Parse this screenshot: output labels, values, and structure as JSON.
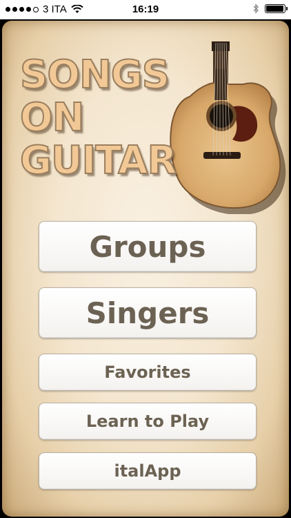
{
  "status_bar": {
    "carrier": "3 ITA",
    "time": "16:19",
    "signal_bars_filled": 4,
    "signal_bars_total": 5,
    "battery_level": 0.95
  },
  "header": {
    "title_lines": [
      "SONGS",
      "ON",
      "GUITAR"
    ]
  },
  "menu": {
    "groups": "Groups",
    "singers": "Singers",
    "favorites": "Favorites",
    "learn": "Learn to Play",
    "italapp": "italApp"
  },
  "icons": {
    "wifi": "wifi-icon",
    "bluetooth": "bluetooth-icon",
    "battery": "battery-icon",
    "guitar": "acoustic-guitar-image"
  },
  "colors": {
    "title_fill": "#f2c996",
    "button_text": "#6c6253",
    "panel_center": "#faf1e2",
    "panel_edge": "#c9a877"
  }
}
